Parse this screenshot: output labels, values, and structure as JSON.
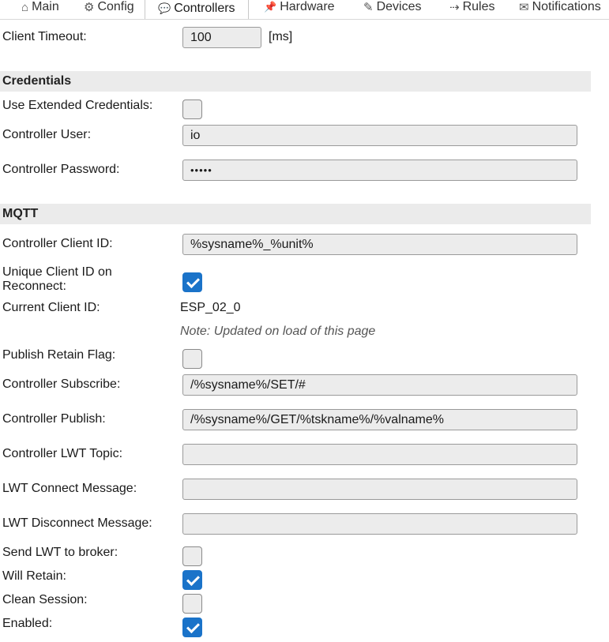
{
  "tabs": [
    {
      "icon": "⌂",
      "icon_name": "home-icon",
      "label": "Main"
    },
    {
      "icon": "⚙",
      "icon_name": "gear-icon",
      "label": "Config"
    },
    {
      "icon": "💬",
      "icon_name": "chat-icon",
      "label": "Controllers",
      "active": true
    },
    {
      "icon": "📌",
      "icon_name": "pin-icon",
      "label": "Hardware"
    },
    {
      "icon": "✎",
      "icon_name": "plug-icon",
      "label": "Devices"
    },
    {
      "icon": "⇢",
      "icon_name": "arrow-icon",
      "label": "Rules"
    },
    {
      "icon": "✉",
      "icon_name": "envelope-icon",
      "label": "Notifications"
    }
  ],
  "client_timeout": {
    "label": "Client Timeout:",
    "value": "100",
    "unit": "[ms]"
  },
  "credentials": {
    "heading": "Credentials",
    "use_extended_label": "Use Extended Credentials:",
    "use_extended_checked": false,
    "user_label": "Controller User:",
    "user_value": "io",
    "password_label": "Controller Password:",
    "password_value": "•••••"
  },
  "mqtt": {
    "heading": "MQTT",
    "client_id_label": "Controller Client ID:",
    "client_id_value": "%sysname%_%unit%",
    "unique_label_line1": "Unique Client ID on",
    "unique_label_line2": "Reconnect:",
    "unique_checked": true,
    "current_id_label": "Current Client ID:",
    "current_id_value": "ESP_02_0",
    "note": "Note: Updated on load of this page",
    "retain_flag_label": "Publish Retain Flag:",
    "retain_flag_checked": false,
    "subscribe_label": "Controller Subscribe:",
    "subscribe_value": "/%sysname%/SET/#",
    "publish_label": "Controller Publish:",
    "publish_value": "/%sysname%/GET/%tskname%/%valname%",
    "lwt_topic_label": "Controller LWT Topic:",
    "lwt_topic_value": "",
    "lwt_connect_label": "LWT Connect Message:",
    "lwt_connect_value": "",
    "lwt_disconnect_label": "LWT Disconnect Message:",
    "lwt_disconnect_value": "",
    "send_lwt_label": "Send LWT to broker:",
    "send_lwt_checked": false,
    "will_retain_label": "Will Retain:",
    "will_retain_checked": true,
    "clean_session_label": "Clean Session:",
    "clean_session_checked": false,
    "enabled_label": "Enabled:",
    "enabled_checked": true
  },
  "colors": {
    "accent": "#1a73c9",
    "section_bg": "#ebebeb",
    "input_bg": "#ececec"
  }
}
